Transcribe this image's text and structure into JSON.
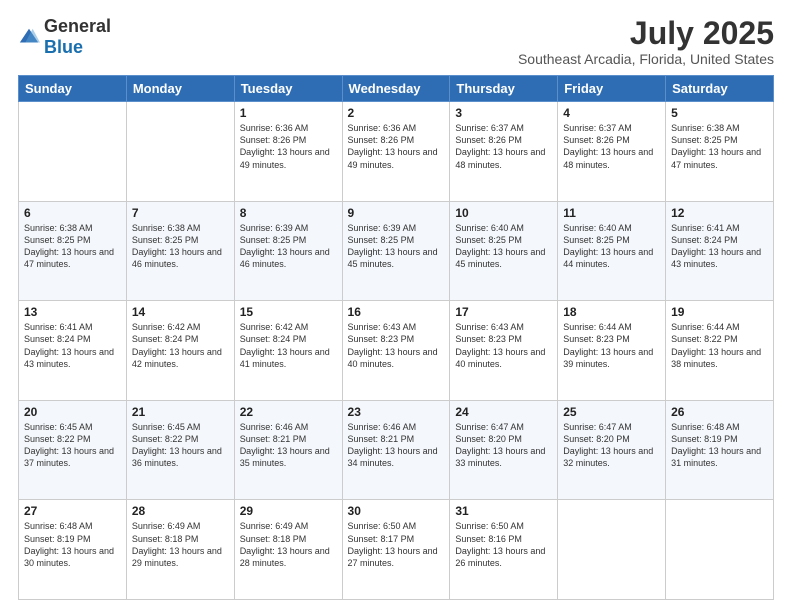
{
  "logo": {
    "general": "General",
    "blue": "Blue"
  },
  "title": "July 2025",
  "location": "Southeast Arcadia, Florida, United States",
  "days_of_week": [
    "Sunday",
    "Monday",
    "Tuesday",
    "Wednesday",
    "Thursday",
    "Friday",
    "Saturday"
  ],
  "weeks": [
    [
      {
        "day": "",
        "info": ""
      },
      {
        "day": "",
        "info": ""
      },
      {
        "day": "1",
        "info": "Sunrise: 6:36 AM\nSunset: 8:26 PM\nDaylight: 13 hours and 49 minutes."
      },
      {
        "day": "2",
        "info": "Sunrise: 6:36 AM\nSunset: 8:26 PM\nDaylight: 13 hours and 49 minutes."
      },
      {
        "day": "3",
        "info": "Sunrise: 6:37 AM\nSunset: 8:26 PM\nDaylight: 13 hours and 48 minutes."
      },
      {
        "day": "4",
        "info": "Sunrise: 6:37 AM\nSunset: 8:26 PM\nDaylight: 13 hours and 48 minutes."
      },
      {
        "day": "5",
        "info": "Sunrise: 6:38 AM\nSunset: 8:25 PM\nDaylight: 13 hours and 47 minutes."
      }
    ],
    [
      {
        "day": "6",
        "info": "Sunrise: 6:38 AM\nSunset: 8:25 PM\nDaylight: 13 hours and 47 minutes."
      },
      {
        "day": "7",
        "info": "Sunrise: 6:38 AM\nSunset: 8:25 PM\nDaylight: 13 hours and 46 minutes."
      },
      {
        "day": "8",
        "info": "Sunrise: 6:39 AM\nSunset: 8:25 PM\nDaylight: 13 hours and 46 minutes."
      },
      {
        "day": "9",
        "info": "Sunrise: 6:39 AM\nSunset: 8:25 PM\nDaylight: 13 hours and 45 minutes."
      },
      {
        "day": "10",
        "info": "Sunrise: 6:40 AM\nSunset: 8:25 PM\nDaylight: 13 hours and 45 minutes."
      },
      {
        "day": "11",
        "info": "Sunrise: 6:40 AM\nSunset: 8:25 PM\nDaylight: 13 hours and 44 minutes."
      },
      {
        "day": "12",
        "info": "Sunrise: 6:41 AM\nSunset: 8:24 PM\nDaylight: 13 hours and 43 minutes."
      }
    ],
    [
      {
        "day": "13",
        "info": "Sunrise: 6:41 AM\nSunset: 8:24 PM\nDaylight: 13 hours and 43 minutes."
      },
      {
        "day": "14",
        "info": "Sunrise: 6:42 AM\nSunset: 8:24 PM\nDaylight: 13 hours and 42 minutes."
      },
      {
        "day": "15",
        "info": "Sunrise: 6:42 AM\nSunset: 8:24 PM\nDaylight: 13 hours and 41 minutes."
      },
      {
        "day": "16",
        "info": "Sunrise: 6:43 AM\nSunset: 8:23 PM\nDaylight: 13 hours and 40 minutes."
      },
      {
        "day": "17",
        "info": "Sunrise: 6:43 AM\nSunset: 8:23 PM\nDaylight: 13 hours and 40 minutes."
      },
      {
        "day": "18",
        "info": "Sunrise: 6:44 AM\nSunset: 8:23 PM\nDaylight: 13 hours and 39 minutes."
      },
      {
        "day": "19",
        "info": "Sunrise: 6:44 AM\nSunset: 8:22 PM\nDaylight: 13 hours and 38 minutes."
      }
    ],
    [
      {
        "day": "20",
        "info": "Sunrise: 6:45 AM\nSunset: 8:22 PM\nDaylight: 13 hours and 37 minutes."
      },
      {
        "day": "21",
        "info": "Sunrise: 6:45 AM\nSunset: 8:22 PM\nDaylight: 13 hours and 36 minutes."
      },
      {
        "day": "22",
        "info": "Sunrise: 6:46 AM\nSunset: 8:21 PM\nDaylight: 13 hours and 35 minutes."
      },
      {
        "day": "23",
        "info": "Sunrise: 6:46 AM\nSunset: 8:21 PM\nDaylight: 13 hours and 34 minutes."
      },
      {
        "day": "24",
        "info": "Sunrise: 6:47 AM\nSunset: 8:20 PM\nDaylight: 13 hours and 33 minutes."
      },
      {
        "day": "25",
        "info": "Sunrise: 6:47 AM\nSunset: 8:20 PM\nDaylight: 13 hours and 32 minutes."
      },
      {
        "day": "26",
        "info": "Sunrise: 6:48 AM\nSunset: 8:19 PM\nDaylight: 13 hours and 31 minutes."
      }
    ],
    [
      {
        "day": "27",
        "info": "Sunrise: 6:48 AM\nSunset: 8:19 PM\nDaylight: 13 hours and 30 minutes."
      },
      {
        "day": "28",
        "info": "Sunrise: 6:49 AM\nSunset: 8:18 PM\nDaylight: 13 hours and 29 minutes."
      },
      {
        "day": "29",
        "info": "Sunrise: 6:49 AM\nSunset: 8:18 PM\nDaylight: 13 hours and 28 minutes."
      },
      {
        "day": "30",
        "info": "Sunrise: 6:50 AM\nSunset: 8:17 PM\nDaylight: 13 hours and 27 minutes."
      },
      {
        "day": "31",
        "info": "Sunrise: 6:50 AM\nSunset: 8:16 PM\nDaylight: 13 hours and 26 minutes."
      },
      {
        "day": "",
        "info": ""
      },
      {
        "day": "",
        "info": ""
      }
    ]
  ]
}
